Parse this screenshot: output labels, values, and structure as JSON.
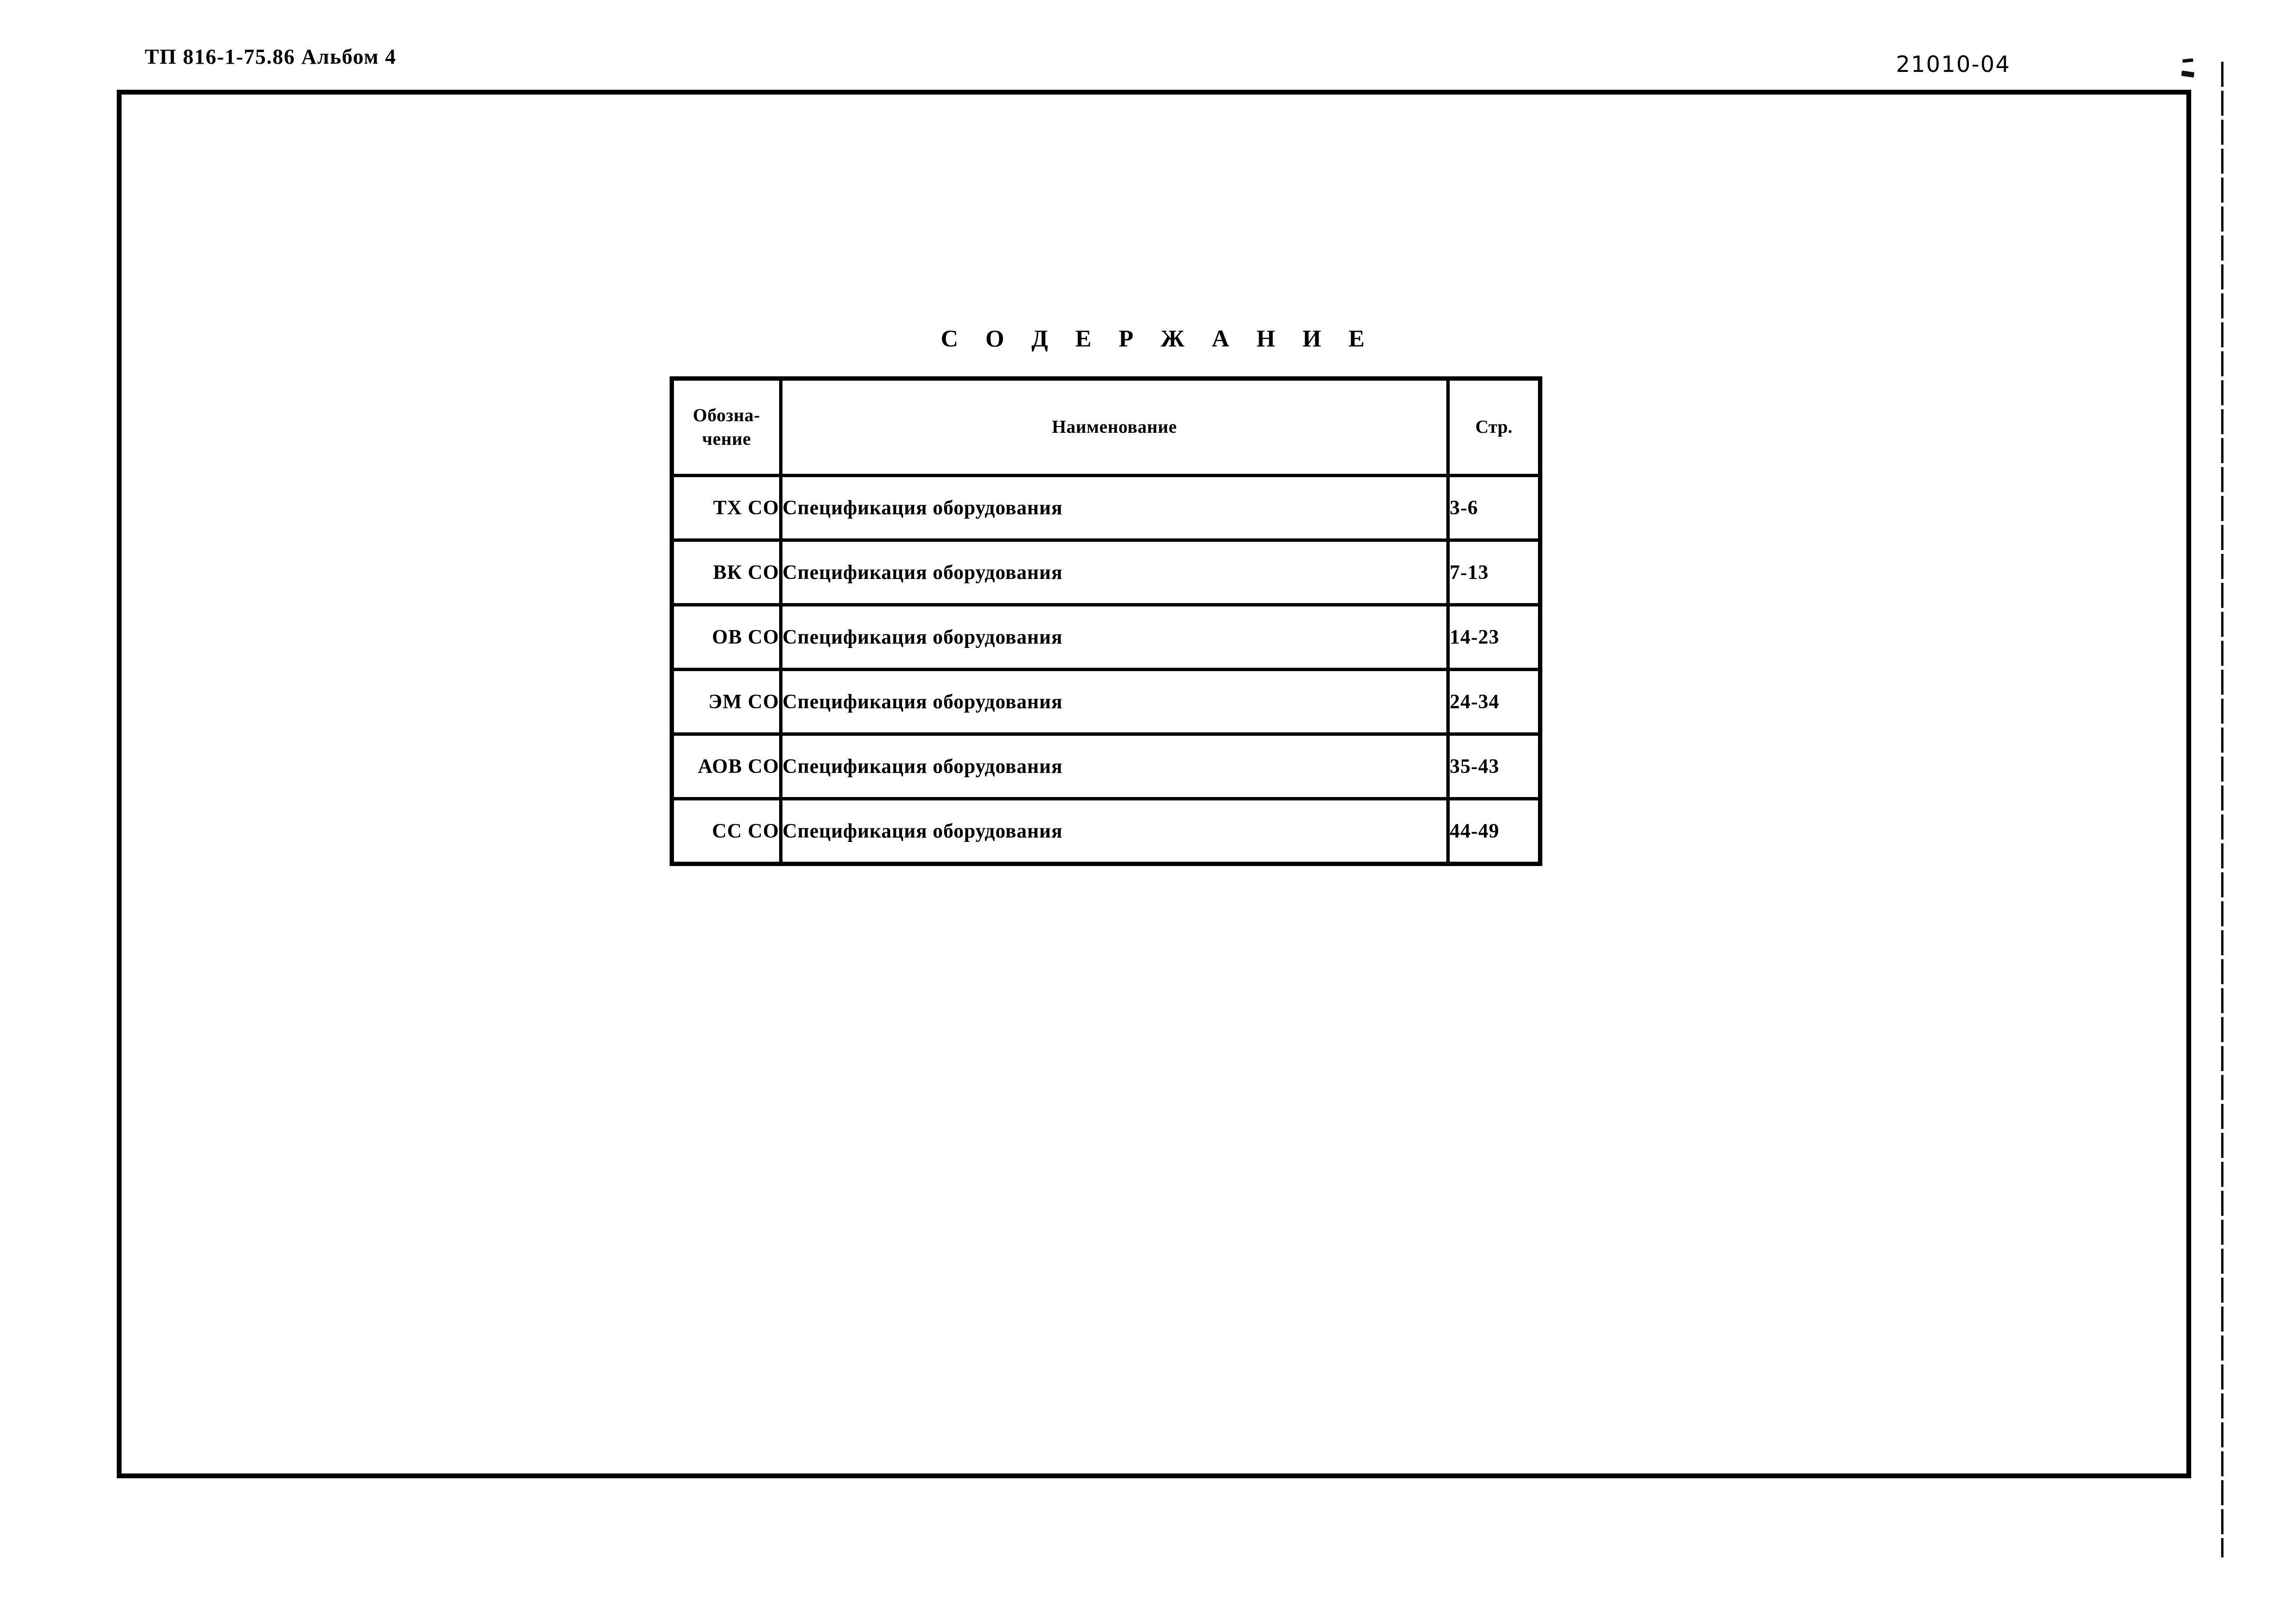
{
  "header": {
    "doc_code": "ТП 816-1-75.86  Альбом 4",
    "sheet_code": "21010-04"
  },
  "contents": {
    "title": "С О Д Е Р Ж А Н И Е",
    "columns": {
      "designation": "Обозна-\nчение",
      "designation_line1": "Обозна-",
      "designation_line2": "чение",
      "name": "Наименование",
      "page": "Стр."
    },
    "rows": [
      {
        "designation": "ТХ СО",
        "name": "Спецификация оборудования",
        "page": "3-6"
      },
      {
        "designation": "ВК СО",
        "name": "Спецификация оборудования",
        "page": "7-13"
      },
      {
        "designation": "ОВ СО",
        "name": "Спецификация оборудования",
        "page": "14-23"
      },
      {
        "designation": "ЭМ СО",
        "name": "Спецификация оборудования",
        "page": "24-34"
      },
      {
        "designation": "АОВ СО",
        "name": "Спецификация оборудования",
        "page": "35-43"
      },
      {
        "designation": "СС СО",
        "name": "Спецификация оборудования",
        "page": "44-49"
      }
    ]
  },
  "colors": {
    "ink": "#000000",
    "paper": "#ffffff"
  }
}
